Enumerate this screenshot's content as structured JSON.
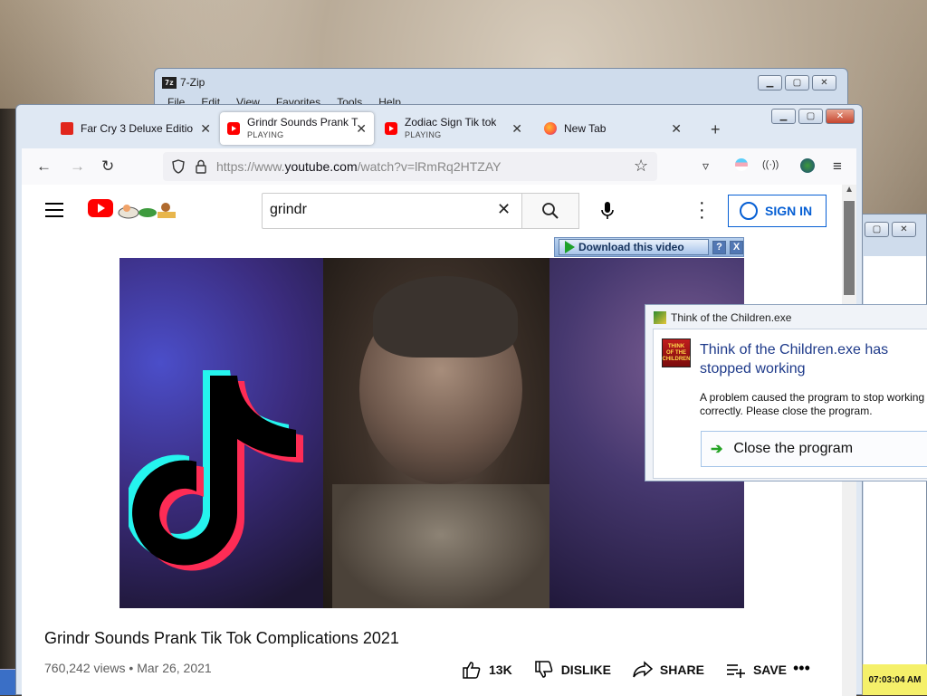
{
  "zip_window": {
    "title": "7-Zip",
    "menu": [
      "File",
      "Edit",
      "View",
      "Favorites",
      "Tools",
      "Help"
    ]
  },
  "browser": {
    "tabs": [
      {
        "title": "Far Cry 3 Deluxe Editio",
        "subtitle": "",
        "favicon": "lock-icon",
        "active": false
      },
      {
        "title": "Grindr Sounds Prank T",
        "subtitle": "PLAYING",
        "favicon": "youtube-icon",
        "active": true
      },
      {
        "title": "Zodiac Sign Tik tok",
        "subtitle": "PLAYING",
        "favicon": "youtube-icon",
        "active": false
      },
      {
        "title": "New Tab",
        "subtitle": "",
        "favicon": "firefox-icon",
        "active": false
      }
    ],
    "new_tab_label": "+",
    "url_prefix": "https://www.",
    "url_domain": "youtube.com",
    "url_path": "/watch?v=lRmRq2HTZAY"
  },
  "youtube": {
    "search_value": "grindr",
    "sign_in_label": "SIGN IN",
    "download_label": "Download this video",
    "help_label": "?",
    "close_label": "X",
    "video_title": "Grindr Sounds Prank Tik Tok Complications 2021",
    "views": "760,242 views",
    "date": "Mar 26, 2021",
    "meta_separator": "•",
    "likes": "13K",
    "dislike_label": "DISLIKE",
    "share_label": "SHARE",
    "save_label": "SAVE",
    "more_label": "•••"
  },
  "error_dialog": {
    "title": "Think of the Children.exe",
    "logo_text": "THINK OF THE CHILDREN",
    "heading": "Think of the Children.exe has stopped working",
    "description": "A problem caused the program to stop working correctly. Please close the program.",
    "close_label": "Close the program"
  },
  "clock": "07:03:04 AM",
  "colors": {
    "youtube_red": "#ff0000",
    "signin_blue": "#065fd4",
    "error_heading": "#1e3a8a"
  }
}
